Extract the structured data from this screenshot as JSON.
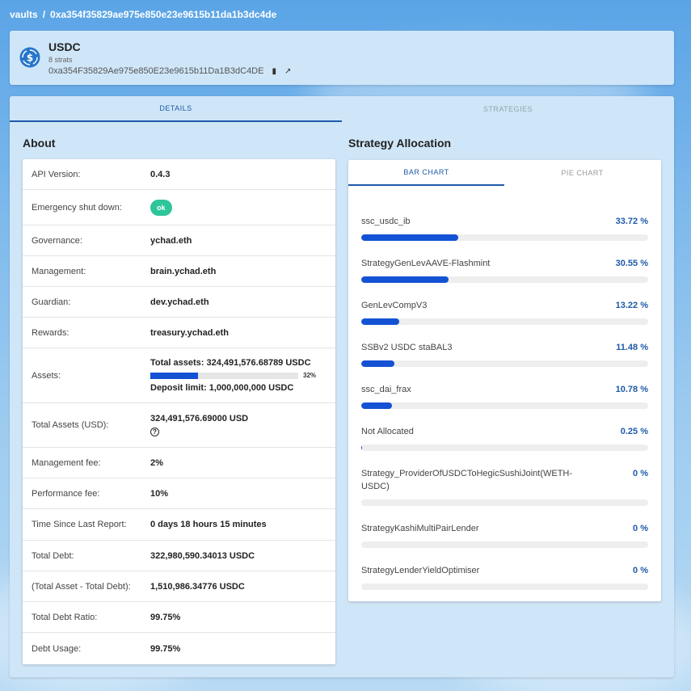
{
  "breadcrumb": {
    "root": "vaults",
    "separator": "/",
    "current": "0xa354f35829ae975e850e23e9615b11da1b3dc4de"
  },
  "vault": {
    "name": "USDC",
    "strats": "8 strats",
    "address": "0xa354F35829Ae975e850E23e9615b11Da1B3dC4DE",
    "copy_icon": "copy-icon",
    "link_icon": "external-link-icon"
  },
  "tabs": [
    {
      "label": "DETAILS",
      "active": true
    },
    {
      "label": "STRATEGIES",
      "active": false
    }
  ],
  "about": {
    "title": "About",
    "rows": {
      "api_version": {
        "label": "API Version:",
        "value": "0.4.3"
      },
      "emergency": {
        "label": "Emergency shut down:",
        "value": "ok"
      },
      "governance": {
        "label": "Governance:",
        "value": "ychad.eth"
      },
      "management": {
        "label": "Management:",
        "value": "brain.ychad.eth"
      },
      "guardian": {
        "label": "Guardian:",
        "value": "dev.ychad.eth"
      },
      "rewards": {
        "label": "Rewards:",
        "value": "treasury.ychad.eth"
      },
      "assets": {
        "label": "Assets:",
        "total": "Total assets: 324,491,576.68789 USDC",
        "percent": 32,
        "percent_label": "32%",
        "limit": "Deposit limit: 1,000,000,000 USDC"
      },
      "total_usd": {
        "label": "Total Assets (USD):",
        "value": "324,491,576.69000 USD"
      },
      "mgmt_fee": {
        "label": "Management fee:",
        "value": "2%"
      },
      "perf_fee": {
        "label": "Performance fee:",
        "value": "10%"
      },
      "last_report": {
        "label": "Time Since Last Report:",
        "value": "0 days 18 hours 15 minutes"
      },
      "total_debt": {
        "label": "Total Debt:",
        "value": "322,980,590.34013 USDC"
      },
      "asset_minus_debt": {
        "label": "(Total Asset - Total Debt):",
        "value": "1,510,986.34776 USDC"
      },
      "debt_ratio": {
        "label": "Total Debt Ratio:",
        "value": "99.75%"
      },
      "debt_usage": {
        "label": "Debt Usage:",
        "value": "99.75%"
      }
    }
  },
  "allocation": {
    "title": "Strategy Allocation",
    "tabs": [
      {
        "label": "BAR CHART",
        "active": true
      },
      {
        "label": "PIE CHART",
        "active": false
      }
    ],
    "strategies": [
      {
        "name": "ssc_usdc_ib",
        "pct_label": "33.72 %",
        "value": 33.72
      },
      {
        "name": "StrategyGenLevAAVE-Flashmint",
        "pct_label": "30.55 %",
        "value": 30.55
      },
      {
        "name": "GenLevCompV3",
        "pct_label": "13.22 %",
        "value": 13.22
      },
      {
        "name": "SSBv2 USDC staBAL3",
        "pct_label": "11.48 %",
        "value": 11.48
      },
      {
        "name": "ssc_dai_frax",
        "pct_label": "10.78 %",
        "value": 10.78
      },
      {
        "name": "Not Allocated",
        "pct_label": "0.25 %",
        "value": 0.25
      },
      {
        "name": "Strategy_ProviderOfUSDCToHegicSushiJoint(WETH-USDC)",
        "pct_label": "0 %",
        "value": 0
      },
      {
        "name": "StrategyKashiMultiPairLender",
        "pct_label": "0 %",
        "value": 0
      },
      {
        "name": "StrategyLenderYieldOptimiser",
        "pct_label": "0 %",
        "value": 0
      }
    ]
  },
  "colors": {
    "accent": "#1452d4",
    "ok": "#2ec59a",
    "tab_active": "#1e5aa8"
  }
}
